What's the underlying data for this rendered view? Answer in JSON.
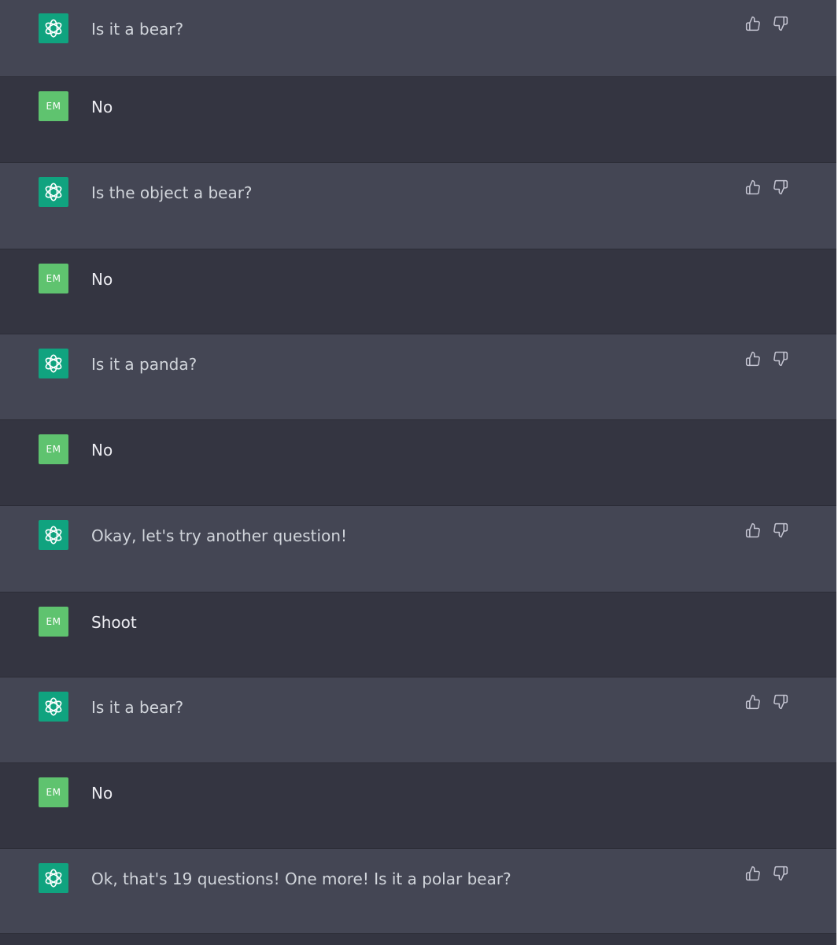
{
  "conversation": {
    "messages": [
      {
        "role": "assistant",
        "text": "Is it a bear?"
      },
      {
        "role": "user",
        "avatar_label": "EM",
        "text": "No"
      },
      {
        "role": "assistant",
        "text": "Is the object a bear?"
      },
      {
        "role": "user",
        "avatar_label": "EM",
        "text": "No"
      },
      {
        "role": "assistant",
        "text": "Is it a panda?"
      },
      {
        "role": "user",
        "avatar_label": "EM",
        "text": "No"
      },
      {
        "role": "assistant",
        "text": "Okay, let's try another question!"
      },
      {
        "role": "user",
        "avatar_label": "EM",
        "text": "Shoot"
      },
      {
        "role": "assistant",
        "text": "Is it a bear?"
      },
      {
        "role": "user",
        "avatar_label": "EM",
        "text": "No"
      },
      {
        "role": "assistant",
        "text": "Ok, that's 19 questions! One more! Is it a polar bear?"
      }
    ]
  },
  "icons": {
    "assistant_avatar": "openai-logo-icon",
    "like": "thumbs-up-icon",
    "dislike": "thumbs-down-icon"
  },
  "colors": {
    "assistant_row": "#444654",
    "user_row": "#343541",
    "assistant_avatar_bg": "#10a37f",
    "user_avatar_bg": "#5fc36f"
  }
}
